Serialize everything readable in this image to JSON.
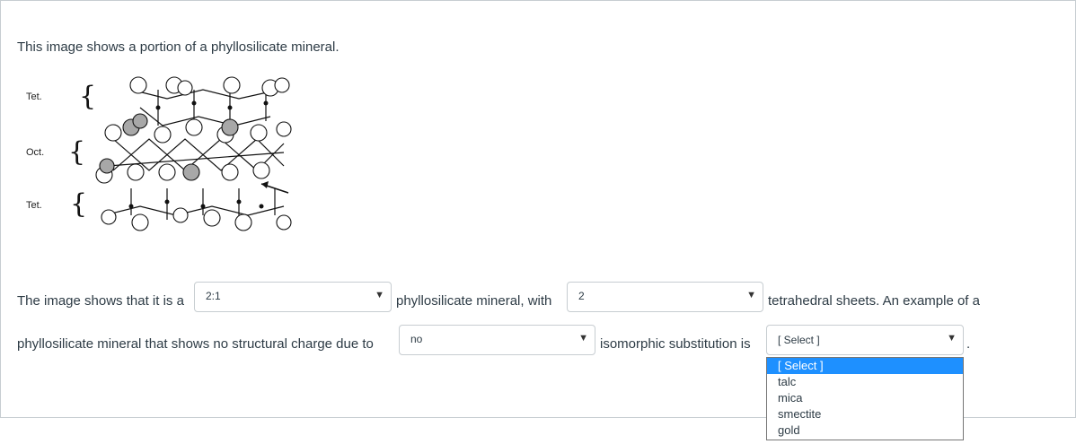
{
  "intro": "This image shows a portion of a phyllosilicate mineral.",
  "figure": {
    "labels": [
      "Tet.",
      "Oct.",
      "Tet."
    ]
  },
  "sentence": {
    "part1": "The image shows that it is a",
    "part2": "phyllosilicate mineral, with",
    "part3": "tetrahedral sheets. An example of a",
    "part4": "phyllosilicate mineral that shows no structural charge due to",
    "part5": "isomorphic substitution is",
    "part6": "."
  },
  "selects": {
    "layer_type": "2:1",
    "sheet_count": "2",
    "substitution": "no",
    "example": "[ Select ]"
  },
  "dropdown": {
    "options": [
      "[ Select ]",
      "talc",
      "mica",
      "smectite",
      "gold"
    ],
    "highlighted": 0
  },
  "colors": {
    "highlight": "#1e90ff",
    "text": "#2d3b45"
  }
}
